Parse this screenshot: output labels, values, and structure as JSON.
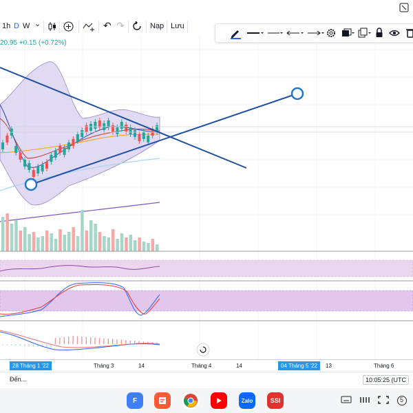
{
  "toolbar": {
    "intervals": [
      "1h",
      "D",
      "W"
    ],
    "interval_dropdown": "⌄",
    "active_interval": "D",
    "undo": "↶",
    "redo": "↷",
    "load_label": "Nạp",
    "save_label": "Lưu"
  },
  "price_info": "20.95 +0.15 (+0.72%)",
  "time_axis": {
    "ticks": [
      {
        "label": "28 Tháng 1 '22",
        "highlight": true
      },
      {
        "label": "Tháng 3",
        "highlight": false
      },
      {
        "label": "14",
        "highlight": false
      },
      {
        "label": "Tháng 4",
        "highlight": false
      },
      {
        "label": "14",
        "highlight": false
      },
      {
        "label": "04 Tháng 5 '22",
        "highlight": true
      },
      {
        "label": "13",
        "highlight": false
      },
      {
        "label": "Tháng 6",
        "highlight": false
      }
    ]
  },
  "bottom": {
    "goto_label": "Đến...",
    "clock": "10:05:25 (UTC"
  },
  "dock": {
    "apps": [
      {
        "name": "F",
        "color": "#3f7ff6"
      },
      {
        "name": "",
        "color": "#ff5a36"
      },
      {
        "name": "",
        "color": "#ffffff"
      },
      {
        "name": "",
        "color": "#ff0000"
      },
      {
        "name": "Zalo",
        "color": "#0a68ff"
      },
      {
        "name": "SSI",
        "color": "#e03030"
      }
    ],
    "page_indicator": "5"
  },
  "colors": {
    "up": "#26a69a",
    "down": "#ef5350",
    "trendline": "#1e4fa0",
    "band_fill": "#d7cdef",
    "accent": "#2962ff"
  }
}
